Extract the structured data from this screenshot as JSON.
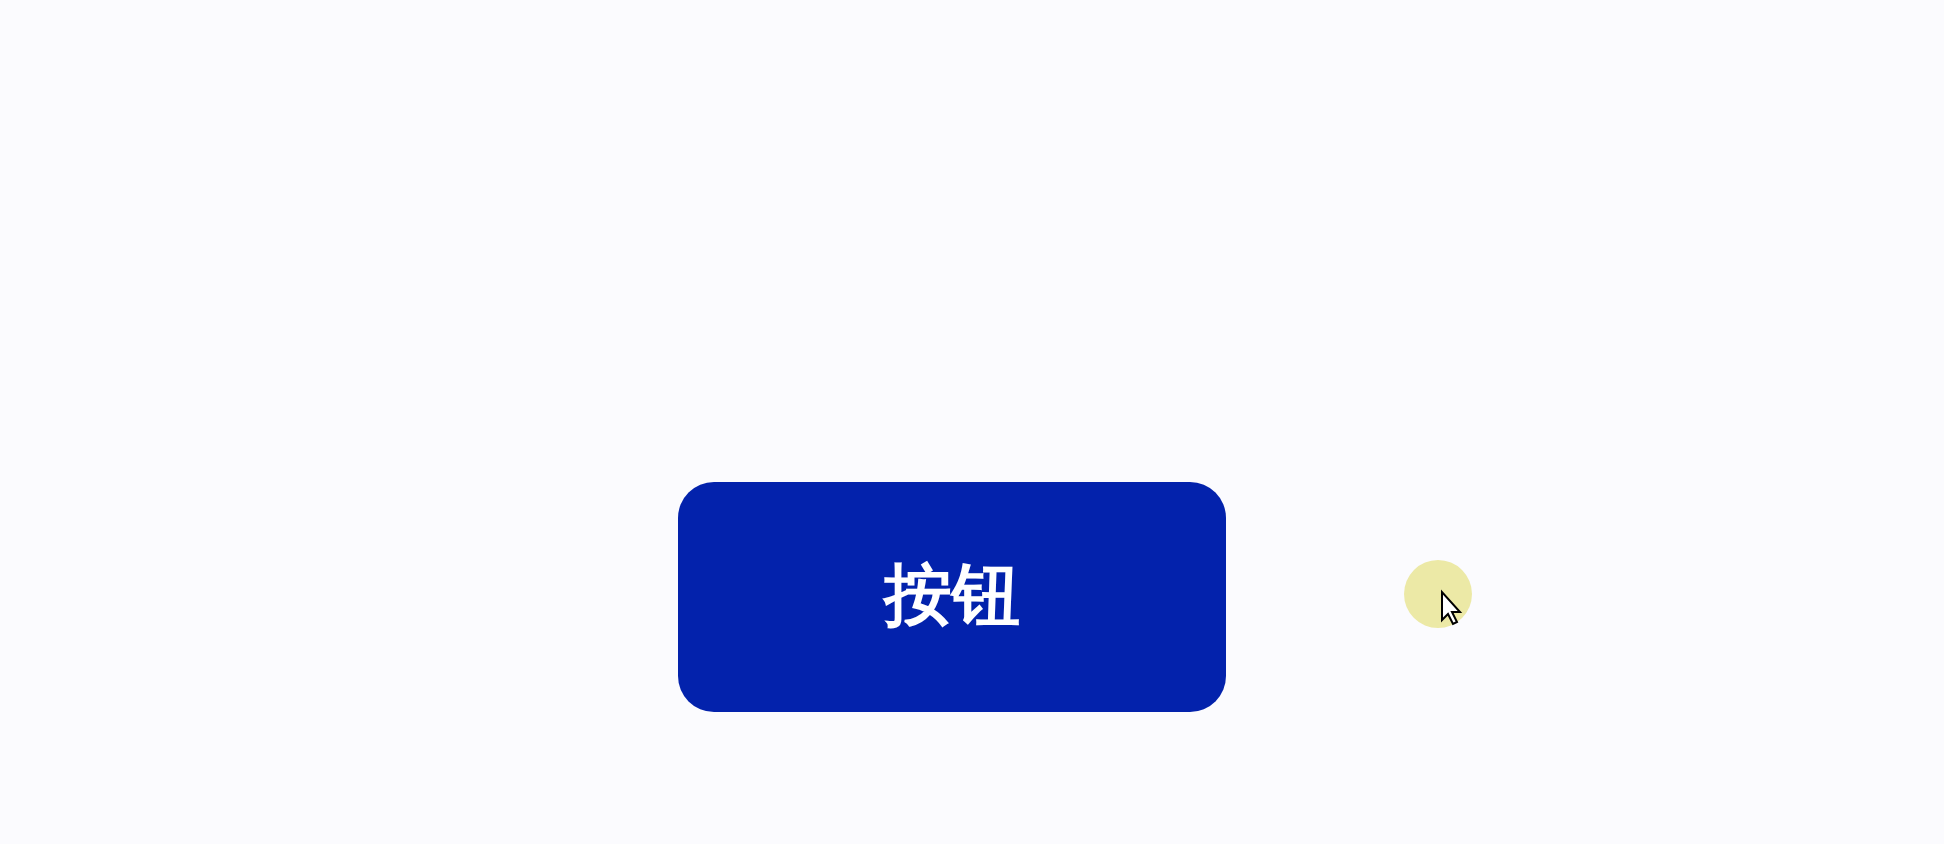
{
  "button": {
    "label": "按钮"
  }
}
